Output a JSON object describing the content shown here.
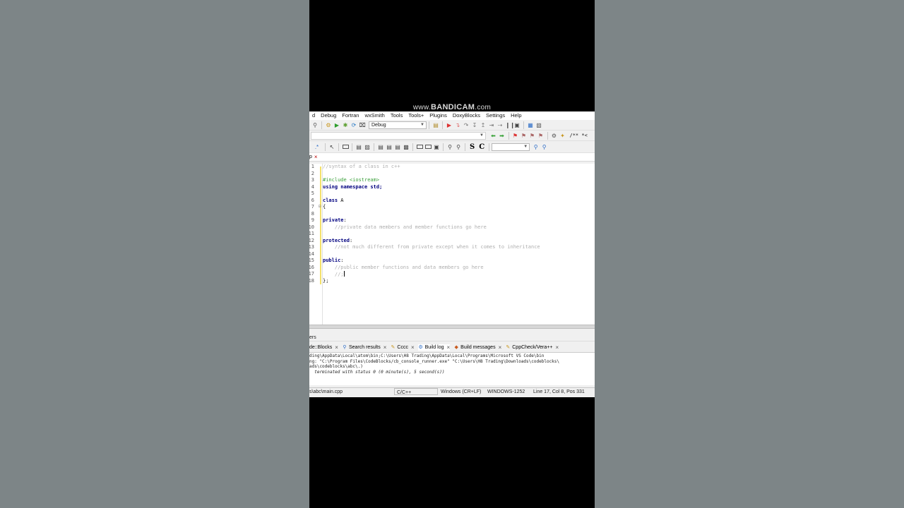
{
  "watermark": {
    "prefix": "www.",
    "brand": "BANDICAM",
    "suffix": ".com"
  },
  "menu": [
    "d",
    "Debug",
    "Fortran",
    "wxSmith",
    "Tools",
    "Tools+",
    "Plugins",
    "DoxyBlocks",
    "Settings",
    "Help"
  ],
  "toolbar": {
    "build_target": "Debug",
    "search_text": "",
    "comment_label": "/** *<"
  },
  "editor": {
    "tab_label": "p",
    "lines": [
      "1",
      "2",
      "3",
      "4",
      "5",
      "6",
      "7",
      "8",
      "9",
      "10",
      "11",
      "12",
      "13",
      "14",
      "15",
      "16",
      "17",
      "18"
    ],
    "code": {
      "l1": "//syntax of a class in c++",
      "l3": "#include <iostream>",
      "l4_kw": "using namespace",
      "l4_rest": " std;",
      "l6_kw": "class",
      "l6_rest": " A",
      "l7": "{",
      "l9_kw": "private",
      "l9_rest": ":",
      "l10": "    //private data members and member functions go here",
      "l12_kw": "protected",
      "l12_rest": ":",
      "l13": "    //not much different from private except when it comes to inheritance",
      "l15_kw": "public",
      "l15_rest": ":",
      "l16": "    //public member functions and data members go here",
      "l17": "    //;",
      "l18": "};"
    }
  },
  "logs": {
    "header": "ers",
    "tabs": [
      {
        "label": "de::Blocks"
      },
      {
        "label": "Search results"
      },
      {
        "label": "Cccc"
      },
      {
        "label": "Build log"
      },
      {
        "label": "Build messages"
      },
      {
        "label": "CppCheck/Vera++"
      }
    ],
    "lines": [
      "ding\\AppData\\Local\\atom\\bin;C:\\Users\\H8 Trading\\AppData\\Local\\Programs\\Microsoft VS Code\\bin",
      "ng: \"C:\\Program Files\\CodeBlocks/cb_console_runner.exe\" \"C:\\Users\\H8 Trading\\Downloads\\codeblocks\\",
      "ads\\codeblocks\\abc\\.)",
      "  terminated with status 0 (0 minute(s), 5 second(s))"
    ]
  },
  "status": {
    "file": "s\\abc\\main.cpp",
    "language": "C/C++",
    "eol": "Windows (CR+LF)",
    "encoding": "WINDOWS-1252",
    "position": "Line 17, Col 8, Pos 331"
  }
}
